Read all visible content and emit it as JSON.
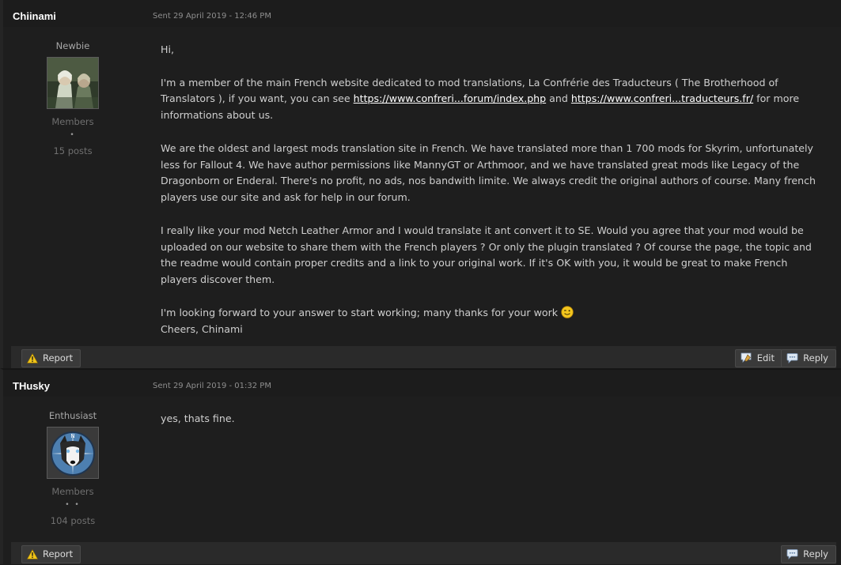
{
  "posts": [
    {
      "author": "Chiinami",
      "date": "Sent 29 April 2019 - 12:46 PM",
      "user_title": "Newbie",
      "group": "Members",
      "pips": "•",
      "post_count": "15 posts",
      "paragraphs": {
        "p1": "Hi,",
        "p2_pre": "I'm a member of the main French website dedicated to mod translations, La Confrérie des Traducteurs ( The Brotherhood of Translators ), if you want, you can see ",
        "link1": "https://www.confreri...forum/index.php",
        "p2_mid": " and ",
        "link2": "https://www.confreri...traducteurs.fr/",
        "p2_post": " for more informations about us.",
        "p3": "We are the oldest and largest mods translation site in French. We have translated more than 1 700 mods for Skyrim, unfortunately less for Fallout 4. We have author permissions like MannyGT or Arthmoor, and we have translated great mods like Legacy of the Dragonborn or Enderal. There's no profit, no ads, nos bandwith limite. We always credit the original authors of course. Many french players use our site and ask for help in our forum.",
        "p4": "I really like your mod Netch Leather Armor and I would translate it ant convert it to SE. Would you agree that your mod would be uploaded on our website to share them with the French players ? Or only the plugin translated ? Of course the page, the topic and the readme would contain proper credits and a link to your original work. If it's OK with you, it would be great to make French players discover them.",
        "p5_line1": "I'm looking forward to your answer to start working; many thanks for your work ",
        "p5_line2": "Cheers, Chinami"
      },
      "buttons": {
        "report": "Report",
        "edit": "Edit",
        "reply": "Reply"
      }
    },
    {
      "author": "THusky",
      "date": "Sent 29 April 2019 - 01:32 PM",
      "user_title": "Enthusiast",
      "group": "Members",
      "pips": "• •",
      "post_count": "104 posts",
      "paragraphs": {
        "p1": "yes, thats fine."
      },
      "buttons": {
        "report": "Report",
        "reply": "Reply"
      }
    }
  ],
  "icons": {
    "report": "warning-icon",
    "edit": "edit-icon",
    "reply": "reply-icon",
    "wink": "wink-emoji-icon"
  },
  "colors": {
    "background": "#1b1b1b",
    "post_bg": "#1e1e1e",
    "footer_bg": "#2a2a2a",
    "warning": "#f0c419"
  }
}
